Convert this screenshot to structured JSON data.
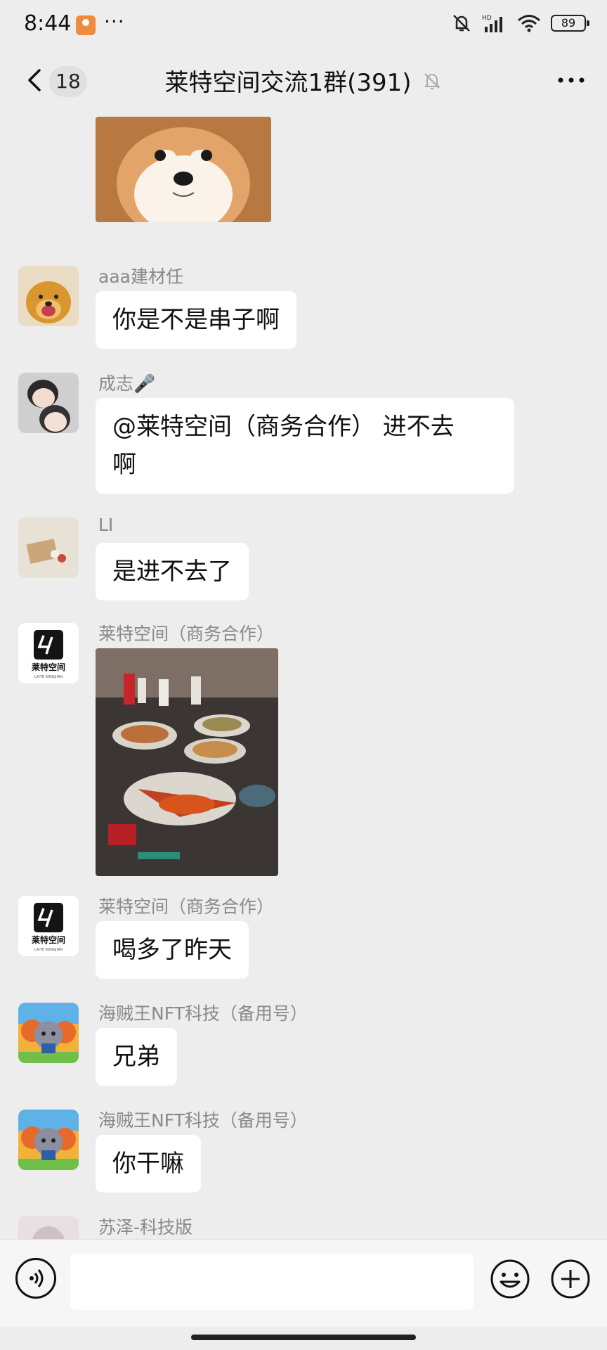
{
  "status_bar": {
    "time": "8:44",
    "battery": "89",
    "icons": [
      "app-badge-icon",
      "silent-bell-icon",
      "hd-signal-icon",
      "wifi-icon",
      "battery-icon"
    ]
  },
  "header": {
    "unread_count": "18",
    "title": "莱特空间交流1群(391)",
    "icons": [
      "back-chevron-icon",
      "mute-bell-icon",
      "more-dots-icon"
    ]
  },
  "messages": [
    {
      "sender": "",
      "type": "image",
      "image": "shiba-dog-photo"
    },
    {
      "sender": "aaa建材任",
      "type": "text",
      "text": "你是不是串子啊"
    },
    {
      "sender": "成志🎤",
      "type": "text",
      "text_lines": [
        "@莱特空间（商务合作） 进不去",
        "啊"
      ]
    },
    {
      "sender": "LI",
      "type": "text",
      "text": "是进不去了"
    },
    {
      "sender": "莱特空间（商务合作）",
      "type": "image",
      "image": "dinner-table-photo"
    },
    {
      "sender": "莱特空间（商务合作）",
      "type": "text",
      "text": "喝多了昨天"
    },
    {
      "sender": "海贼王NFT科技（备用号）",
      "type": "text",
      "text": "兄弟"
    },
    {
      "sender": "海贼王NFT科技（备用号）",
      "type": "text",
      "text": "你干嘛"
    },
    {
      "sender": "苏泽-科技版",
      "type": "text",
      "text": ""
    }
  ],
  "logo": {
    "brand_cn": "莱特空间",
    "brand_en": "LAITE KONGJIAN"
  },
  "input_bar": {
    "placeholder": "",
    "icons": [
      "voice-icon",
      "emoji-icon",
      "plus-icon"
    ]
  },
  "colors": {
    "background": "#ededed",
    "bubble": "#ffffff",
    "sender_name": "#8a8a8a"
  }
}
